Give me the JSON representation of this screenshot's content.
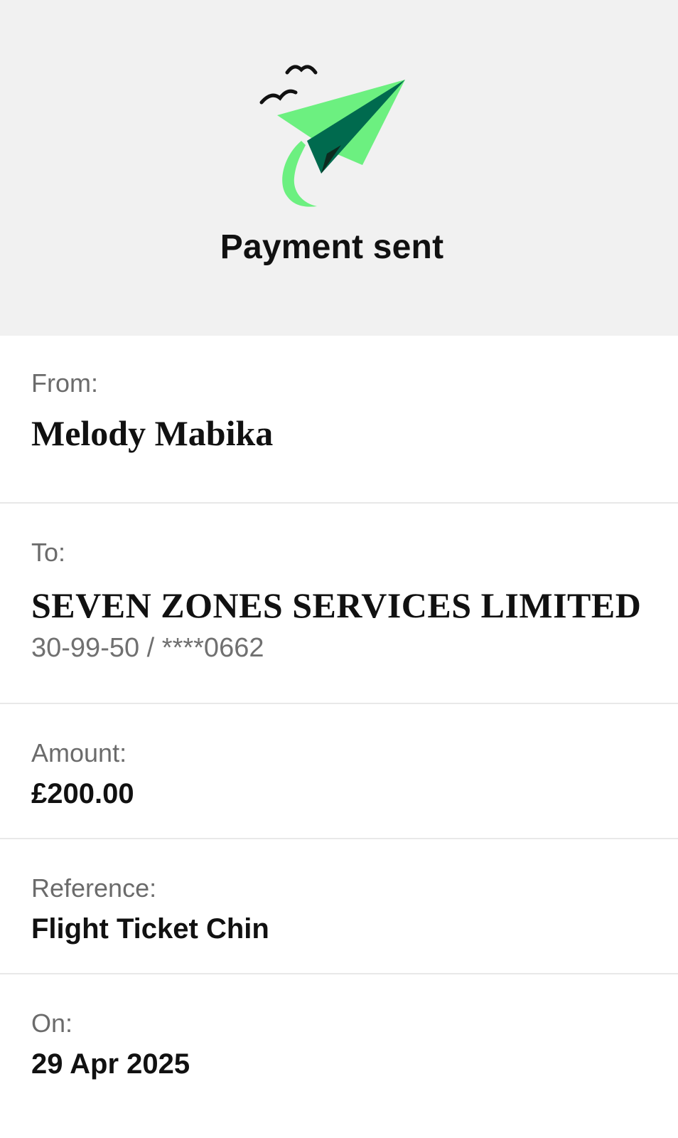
{
  "header": {
    "title": "Payment sent",
    "illustration_icon": "paper-plane-with-birds-icon",
    "colors": {
      "plane_light": "#6cf080",
      "plane_dark": "#006a4e",
      "plane_shadow": "#0d2a1f",
      "birds": "#111111",
      "background": "#f1f1f1"
    }
  },
  "details": {
    "from": {
      "label": "From:",
      "value": "Melody Mabika"
    },
    "to": {
      "label": "To:",
      "value": "SEVEN ZONES SERVICES LIMITED",
      "account": "30-99-50 / ****0662"
    },
    "amount": {
      "label": "Amount:",
      "value": "£200.00"
    },
    "reference": {
      "label": "Reference:",
      "value": "Flight Ticket Chin"
    },
    "on": {
      "label": "On:",
      "value": "29 Apr 2025"
    }
  }
}
